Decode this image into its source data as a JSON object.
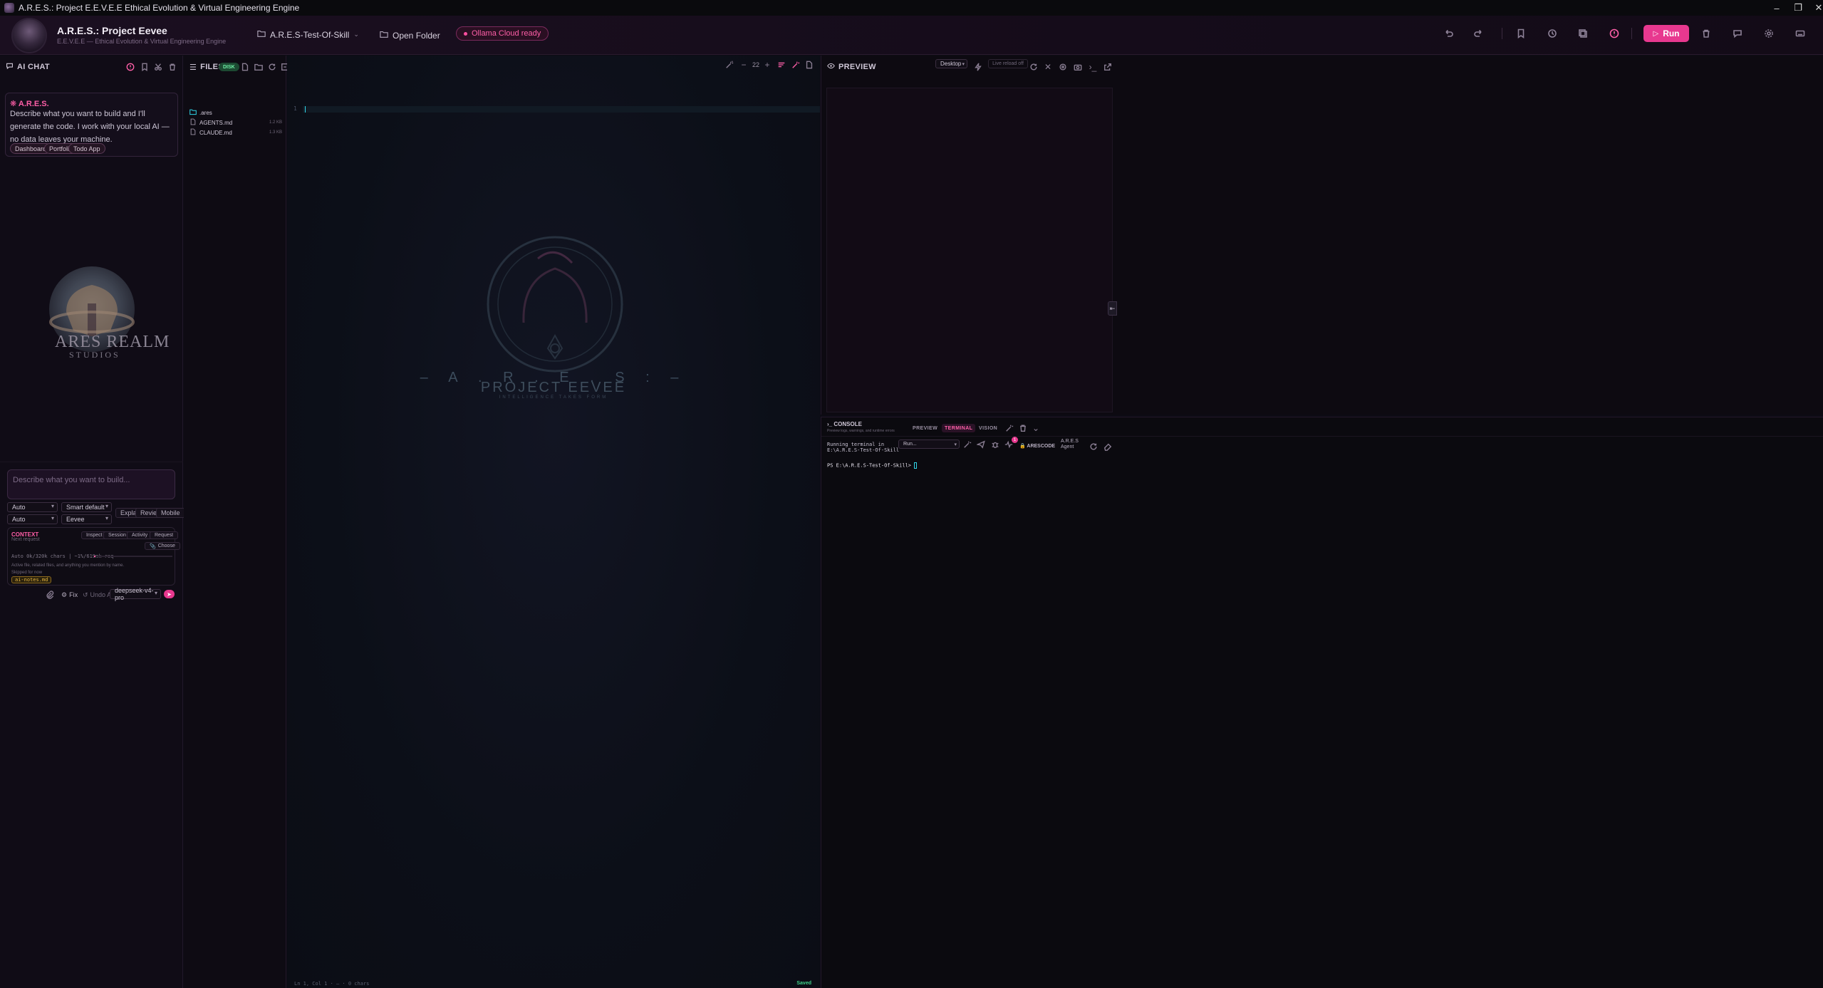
{
  "window": {
    "title": "A.R.E.S.: Project E.E.V.E.E Ethical Evolution & Virtual Engineering Engine"
  },
  "header": {
    "brand_title": "A.R.E.S.: Project Eevee",
    "brand_subtitle": "E.E.V.E.E — Ethical Evolution & Virtual Engineering Engine",
    "workspace": "A.R.E.S-Test-Of-Skill",
    "open_folder": "Open Folder",
    "ollama_status": "Ollama Cloud ready",
    "run_label": "Run"
  },
  "chat": {
    "title": "AI CHAT",
    "assistant_name": "A.R.E.S.",
    "greeting": "Describe what you want to build and I'll generate the code. I work with your local AI — no data leaves your machine.",
    "suggestions": [
      "Dashboard",
      "Portfolio",
      "Todo App"
    ],
    "logo_line1": "ARES REALM",
    "logo_line2": "STUDIOS",
    "composer_placeholder": "Describe what you want to build...",
    "select_mode_1": "Auto",
    "select_mode_2": "Smart default",
    "select_mode_3": "Auto",
    "select_persona": "Eevee",
    "quick_actions": [
      "Explain",
      "Review",
      "Mobile"
    ],
    "context": {
      "title": "CONTEXT",
      "subtitle": "Next request",
      "tabs": [
        "Inspect",
        "Session",
        "Activity",
        "Request"
      ],
      "choose": "Choose",
      "usage": "Auto 0k/320k chars | ~1%/619mk req",
      "usage_fraction": 0.02,
      "description": "Active file, related files, and anything you mention by name.",
      "skipped": "Skipped for now",
      "file_chip": "ai-notes.md"
    },
    "fix_label": "Fix",
    "undo_label": "Undo AI",
    "model": "deepseek-v4-pro"
  },
  "files": {
    "title": "FILES",
    "badge": "DISK",
    "items": [
      {
        "name": ".ares",
        "type": "folder",
        "size": ""
      },
      {
        "name": "AGENTS.md",
        "type": "file",
        "size": "1.2 KB"
      },
      {
        "name": "CLAUDE.md",
        "type": "file",
        "size": "1.3 KB"
      }
    ]
  },
  "editor": {
    "font_size": "22",
    "line_number": "1",
    "watermark_line1": "– A . R . E . S : –",
    "watermark_line2": "PROJECT EEVEE",
    "watermark_tagline": "INTELLIGENCE TAKES FORM",
    "status_left": "Ln 1, Col 1  ·  —  ·  0 chars",
    "status_saved": "Saved"
  },
  "preview": {
    "title": "PREVIEW",
    "device": "Desktop",
    "live_reload": "Live reload off"
  },
  "console": {
    "title": "CONSOLE",
    "subtitle": "Preview logs, warnings, and runtime errors",
    "tabs": [
      "PREVIEW",
      "TERMINAL",
      "VISION"
    ],
    "running_line1": "Running terminal in",
    "running_line2": "E:\\A.R.E.S-Test-Of-Skill",
    "run_select": "Run...",
    "notification_count": "1",
    "arescode": "ARESCODE",
    "agent_line1": "A.R.E.S",
    "agent_line2": "Agent",
    "prompt": "PS E:\\A.R.E.S-Test-Of-Skill>"
  },
  "colors": {
    "accent": "#e8388f",
    "accent_text": "#ff5fa8",
    "success": "#3fd18a",
    "cursor": "#2fd5e8"
  }
}
